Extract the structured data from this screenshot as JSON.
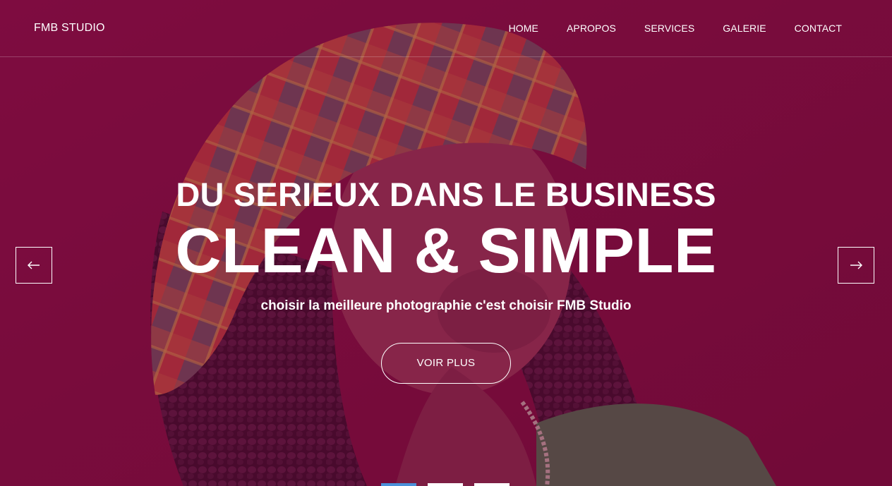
{
  "brand": "FMB STUDIO",
  "nav": {
    "items": [
      {
        "label": "HOME"
      },
      {
        "label": "APROPOS"
      },
      {
        "label": "SERVICES"
      },
      {
        "label": "GALERIE"
      },
      {
        "label": "CONTACT"
      }
    ]
  },
  "hero": {
    "kicker": "DU SERIEUX DANS LE BUSINESS",
    "headline": "CLEAN & SIMPLE",
    "tagline": "choisir la meilleure photographie c'est choisir FMB Studio",
    "cta_label": "VOIR PLUS",
    "prev_icon": "arrow-left-icon",
    "next_icon": "arrow-right-icon",
    "slides_total": 3,
    "active_slide": 1
  },
  "colors": {
    "overlay": "#7a0d3f",
    "text": "#ffffff",
    "indicator_active": "#4a90d9"
  }
}
